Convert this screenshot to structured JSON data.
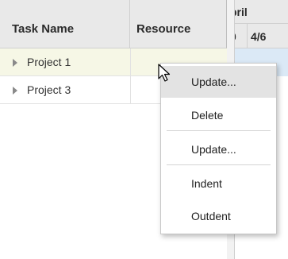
{
  "header": {
    "task_name": "Task Name",
    "resource": "Resource",
    "month": "pril",
    "date_prev": "0",
    "date_current": "4/6"
  },
  "rows": [
    {
      "label": "Project 1",
      "selected": true
    },
    {
      "label": "Project 3",
      "selected": false
    }
  ],
  "context_menu": {
    "items": [
      {
        "label": "Update..."
      },
      {
        "label": "Delete"
      },
      {
        "label": "Update..."
      },
      {
        "label": "Indent"
      },
      {
        "label": "Outdent"
      }
    ]
  },
  "colors": {
    "header_bg": "#e9e9e9",
    "selected_row_bg": "#f6f7e6",
    "chart_selected_bg": "#dbe9f6",
    "menu_hover_bg": "#e3e3e3"
  },
  "icons": {
    "expander": "triangle-right-icon",
    "cursor": "arrow-cursor-icon"
  }
}
